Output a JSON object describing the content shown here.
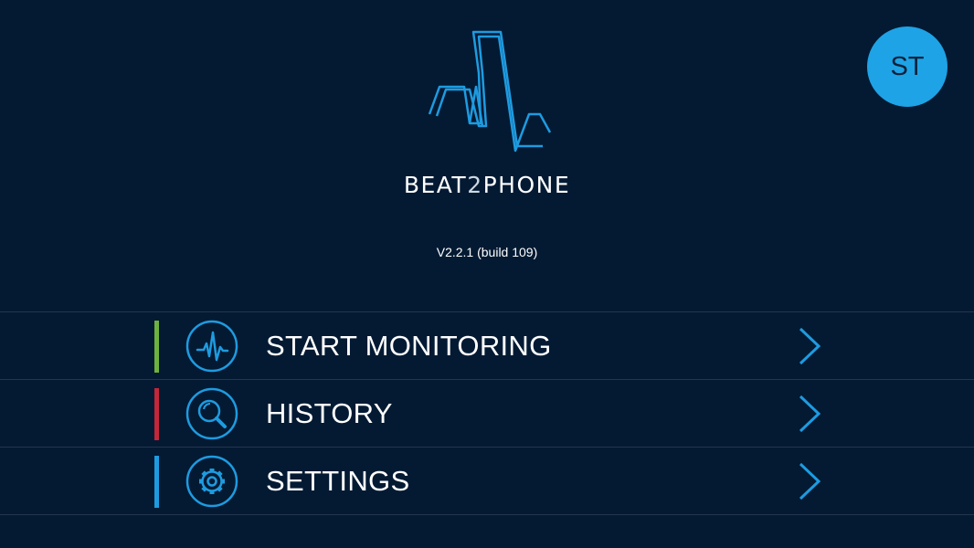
{
  "app": {
    "brand_left": "BEAT",
    "brand_heart": "2",
    "brand_right": "PHONE",
    "version": "V2.2.1 (build 109)"
  },
  "user": {
    "initials": "ST"
  },
  "menu": {
    "items": [
      {
        "label": "START MONITORING",
        "icon": "heartbeat-icon",
        "accent": "#6fb13f"
      },
      {
        "label": "HISTORY",
        "icon": "magnifier-icon",
        "accent": "#c4263a"
      },
      {
        "label": "SETTINGS",
        "icon": "gear-icon",
        "accent": "#1e9be0"
      }
    ]
  },
  "colors": {
    "background": "#041a33",
    "primary": "#1ea3e6",
    "divider": "#23364d"
  }
}
